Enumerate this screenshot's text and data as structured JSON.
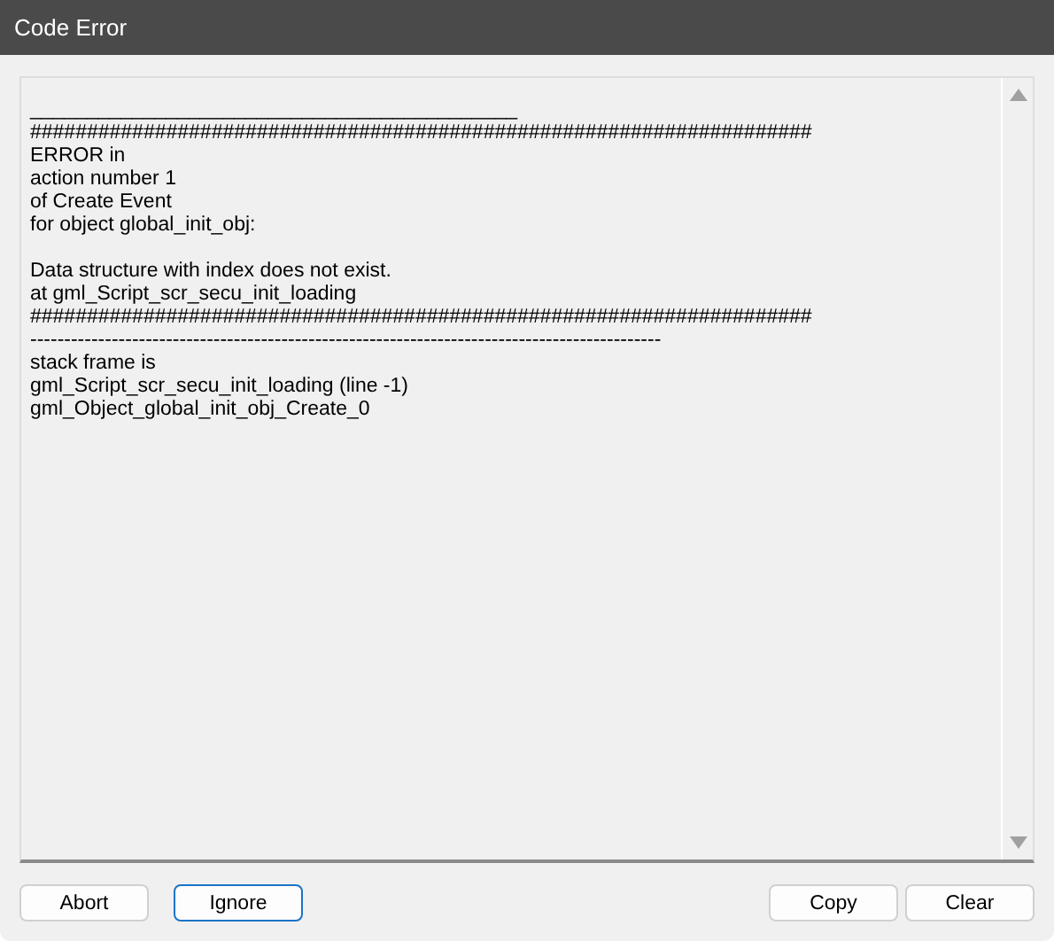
{
  "window": {
    "title": "Code Error"
  },
  "log": {
    "blocks": [
      [
        "___________________________________________",
        "#####################################################################",
        "ERROR in",
        "action number 1",
        "of Create Event",
        "for object global_init_obj:"
      ],
      [
        "Data structure with index does not exist.",
        "at gml_Script_scr_secu_init_loading",
        "#####################################################################",
        "---------------------------------------------------------------------------------------------",
        "stack frame is",
        "gml_Script_scr_secu_init_loading (line -1)",
        "gml_Object_global_init_obj_Create_0"
      ]
    ]
  },
  "buttons_left": [
    {
      "label": "Abort",
      "focused": false
    },
    {
      "label": "Ignore",
      "focused": true
    }
  ],
  "buttons_right": [
    {
      "label": "Copy",
      "focused": false
    },
    {
      "label": "Clear",
      "focused": false
    }
  ]
}
